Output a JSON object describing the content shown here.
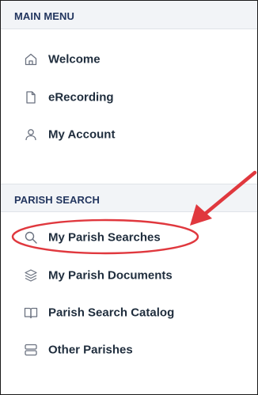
{
  "main_menu": {
    "title": "MAIN MENU",
    "items": [
      {
        "label": "Welcome",
        "icon": "home-icon"
      },
      {
        "label": "eRecording",
        "icon": "document-icon"
      },
      {
        "label": "My Account",
        "icon": "user-icon"
      }
    ]
  },
  "parish_search": {
    "title": "PARISH SEARCH",
    "items": [
      {
        "label": "My Parish Searches",
        "icon": "search-icon"
      },
      {
        "label": "My Parish Documents",
        "icon": "layers-icon"
      },
      {
        "label": "Parish Search Catalog",
        "icon": "book-icon"
      },
      {
        "label": "Other Parishes",
        "icon": "database-icon"
      }
    ]
  },
  "colors": {
    "header_text": "#23365f",
    "item_text": "#1f2d3d",
    "icon": "#6b7280",
    "header_bg": "#f2f4f7",
    "annotation": "#e0383e"
  }
}
